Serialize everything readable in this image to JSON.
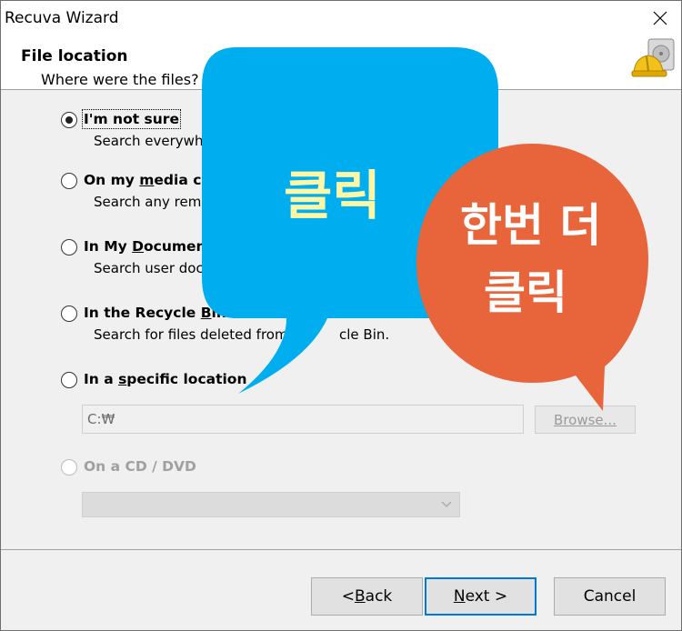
{
  "window": {
    "title": "Recuva Wizard"
  },
  "header": {
    "title": "File location",
    "subtitle": "Where were the files?"
  },
  "options": [
    {
      "label": "I'm not sure",
      "desc": "Search everywhe"
    },
    {
      "label_pre": "On my ",
      "label_ul": "m",
      "label_post": "edia ca",
      "desc": "Search any remo"
    },
    {
      "label_pre": "In My ",
      "label_ul": "D",
      "label_post": "ocument",
      "desc": "Search user docu"
    },
    {
      "label_pre": "In the Recycle ",
      "label_ul": "B",
      "label_post": "in",
      "desc": "Search for files deleted from th",
      "desc_tail": "cle Bin."
    },
    {
      "label_pre": "In a ",
      "label_ul": "s",
      "label_post": "pecific location"
    },
    {
      "label": "On a CD / DVD"
    }
  ],
  "path": {
    "value": "C:₩"
  },
  "browse": {
    "label": "Browse..."
  },
  "buttons": {
    "back_pre": "< ",
    "back_ul": "B",
    "back_post": "ack",
    "next_ul": "N",
    "next_post": "ext >",
    "cancel": "Cancel"
  },
  "overlays": {
    "blue_text": "클릭",
    "orange_line1": "한번 더",
    "orange_line2": "클릭"
  },
  "colors": {
    "blue_bubble": "#00aeef",
    "orange_bubble": "#e8643a",
    "bubble_text_blue": "#fff7a6",
    "bubble_text_orange": "#ffffff",
    "focus": "#0078d7"
  }
}
